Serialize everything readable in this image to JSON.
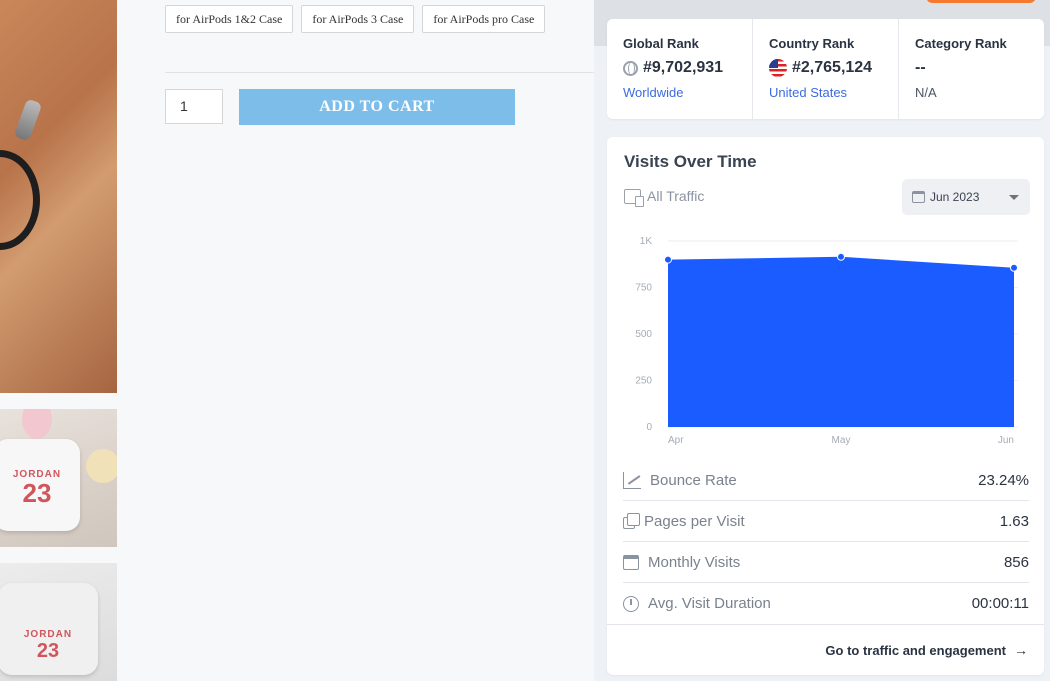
{
  "product": {
    "images": {
      "thumb1_case_text": "JORDAN",
      "thumb1_case_number": "23",
      "thumb2_case_text": "JORDAN",
      "thumb2_case_number": "23"
    },
    "options": [
      "for AirPods 1&2 Case",
      "for AirPods 3 Case",
      "for AirPods pro Case"
    ],
    "quantity": "1",
    "add_to_cart_label": "ADD TO CART"
  },
  "widget": {
    "ranks": [
      {
        "title": "Global Rank",
        "value": "#9,702,931",
        "sub": "Worldwide",
        "icon": "globe-icon"
      },
      {
        "title": "Country Rank",
        "value": "#2,765,124",
        "sub": "United States",
        "icon": "us-flag-icon"
      },
      {
        "title": "Category Rank",
        "value": "--",
        "sub": "N/A",
        "icon": ""
      }
    ],
    "visits_title": "Visits Over Time",
    "traffic_label": "All Traffic",
    "date_label": "Jun 2023",
    "metrics": [
      {
        "label": "Bounce Rate",
        "value": "23.24%",
        "icon": "bounce-icon"
      },
      {
        "label": "Pages per Visit",
        "value": "1.63",
        "icon": "pages-icon"
      },
      {
        "label": "Monthly Visits",
        "value": "856",
        "icon": "calendar-icon"
      },
      {
        "label": "Avg. Visit Duration",
        "value": "00:00:11",
        "icon": "timer-icon"
      }
    ],
    "go_link": "Go to traffic and engagement",
    "colors": {
      "accent": "#1a5cff",
      "link": "#3d6bdf",
      "cart": "#7dbde9"
    }
  },
  "chart_data": {
    "type": "area",
    "categories": [
      "Apr",
      "May",
      "Jun"
    ],
    "series": [
      {
        "values": [
          900,
          915,
          856
        ]
      }
    ],
    "yticks": [
      "0",
      "250",
      "500",
      "750",
      "1K"
    ],
    "ylim": [
      0,
      1000
    ],
    "grid": true,
    "legend": "none"
  }
}
